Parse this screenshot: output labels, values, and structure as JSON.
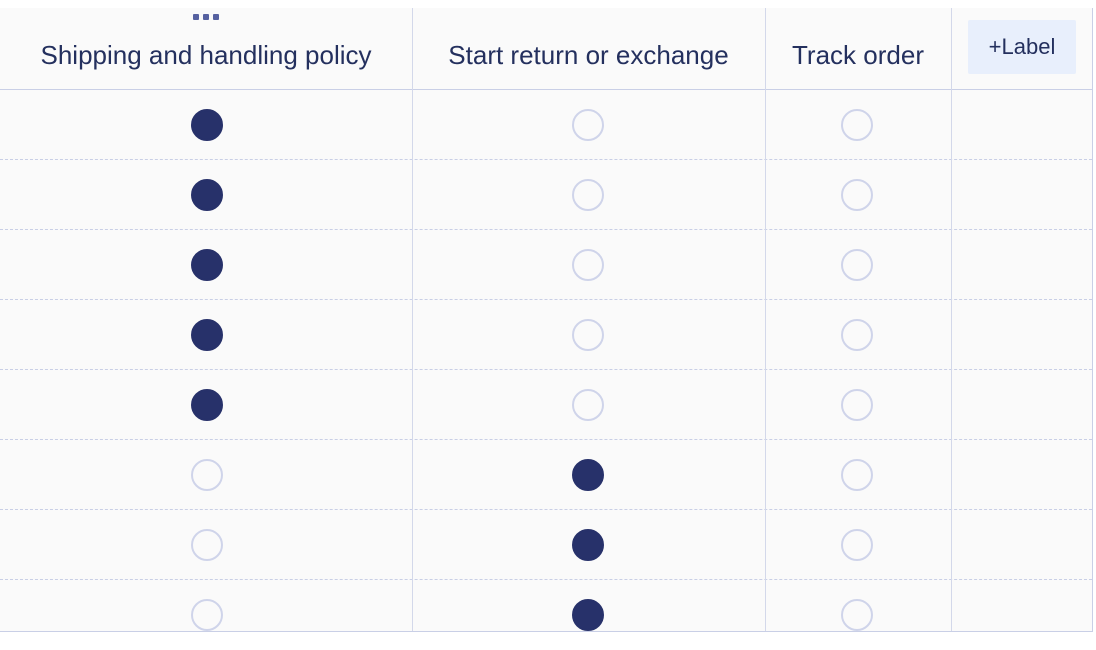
{
  "columns": [
    {
      "label": "Shipping and handling policy"
    },
    {
      "label": "Start return or exchange"
    },
    {
      "label": "Track order"
    }
  ],
  "add_label_button": "+Label",
  "colors": {
    "selected": "#27316a",
    "unselected_border": "#cfd4ea",
    "header_text": "#24305e",
    "add_label_bg": "#e8effc"
  },
  "rows": [
    {
      "selected": 0
    },
    {
      "selected": 0
    },
    {
      "selected": 0
    },
    {
      "selected": 0
    },
    {
      "selected": 0
    },
    {
      "selected": 1
    },
    {
      "selected": 1
    },
    {
      "selected": 1
    }
  ]
}
